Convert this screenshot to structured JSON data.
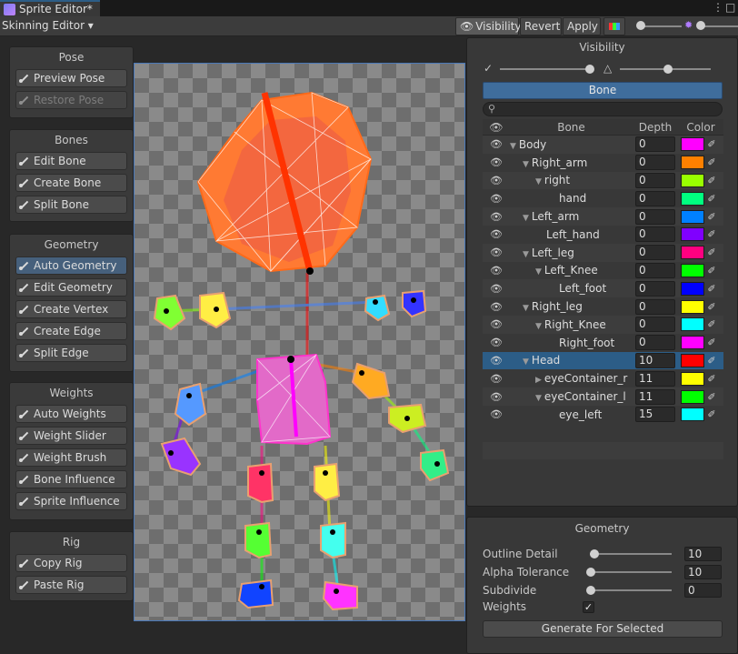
{
  "window": {
    "tab_title": "Sprite Editor*",
    "mode_dropdown": "Skinning Editor ▾",
    "toolbar": {
      "visibility": "Visibility",
      "revert": "Revert",
      "apply": "Apply"
    }
  },
  "tool_panels": {
    "pose": {
      "title": "Pose",
      "items": [
        "Preview Pose",
        "Restore Pose"
      ]
    },
    "bones": {
      "title": "Bones",
      "items": [
        "Edit Bone",
        "Create Bone",
        "Split Bone"
      ]
    },
    "geometry": {
      "title": "Geometry",
      "items": [
        "Auto Geometry",
        "Edit Geometry",
        "Create Vertex",
        "Create Edge",
        "Split Edge"
      ]
    },
    "weights": {
      "title": "Weights",
      "items": [
        "Auto Weights",
        "Weight Slider",
        "Weight Brush",
        "Bone Influence",
        "Sprite Influence"
      ]
    },
    "rig": {
      "title": "Rig",
      "items": [
        "Copy Rig",
        "Paste Rig"
      ]
    }
  },
  "visibility": {
    "title": "Visibility",
    "tab": "Bone",
    "search_placeholder": "",
    "headers": {
      "bone": "Bone",
      "depth": "Depth",
      "color": "Color"
    },
    "bones": [
      {
        "name": "Body",
        "depth": "0",
        "color": "#ff00ff",
        "indent": 0,
        "arrow": "▼"
      },
      {
        "name": "Right_arm",
        "depth": "0",
        "color": "#ff8000",
        "indent": 1,
        "arrow": "▼"
      },
      {
        "name": "right",
        "depth": "0",
        "color": "#99ff00",
        "indent": 2,
        "arrow": "▼"
      },
      {
        "name": "hand",
        "depth": "0",
        "color": "#00ff80",
        "indent": 3,
        "arrow": ""
      },
      {
        "name": "Left_arm",
        "depth": "0",
        "color": "#0080ff",
        "indent": 1,
        "arrow": "▼"
      },
      {
        "name": "Left_hand",
        "depth": "0",
        "color": "#8000ff",
        "indent": 2,
        "arrow": ""
      },
      {
        "name": "Left_leg",
        "depth": "0",
        "color": "#ff0080",
        "indent": 1,
        "arrow": "▼"
      },
      {
        "name": "Left_Knee",
        "depth": "0",
        "color": "#00ff00",
        "indent": 2,
        "arrow": "▼"
      },
      {
        "name": "Left_foot",
        "depth": "0",
        "color": "#0000ff",
        "indent": 3,
        "arrow": ""
      },
      {
        "name": "Right_leg",
        "depth": "0",
        "color": "#ffff00",
        "indent": 1,
        "arrow": "▼"
      },
      {
        "name": "Right_Knee",
        "depth": "0",
        "color": "#00ffff",
        "indent": 2,
        "arrow": "▼"
      },
      {
        "name": "Right_foot",
        "depth": "0",
        "color": "#ff00ff",
        "indent": 3,
        "arrow": ""
      },
      {
        "name": "Head",
        "depth": "10",
        "color": "#ff0000",
        "indent": 1,
        "arrow": "▼",
        "selected": true
      },
      {
        "name": "eyeContainer_r",
        "depth": "11",
        "color": "#ffff00",
        "indent": 2,
        "arrow": "▶"
      },
      {
        "name": "eyeContainer_l",
        "depth": "11",
        "color": "#00ff00",
        "indent": 2,
        "arrow": "▼"
      },
      {
        "name": "eye_left",
        "depth": "15",
        "color": "#00ffff",
        "indent": 3,
        "arrow": ""
      }
    ]
  },
  "geometry": {
    "title": "Geometry",
    "outline_detail": {
      "label": "Outline Detail",
      "value": "10"
    },
    "alpha_tolerance": {
      "label": "Alpha Tolerance",
      "value": "10"
    },
    "subdivide": {
      "label": "Subdivide",
      "value": "0"
    },
    "weights": {
      "label": "Weights",
      "checked": true
    },
    "generate_button": "Generate For Selected"
  }
}
